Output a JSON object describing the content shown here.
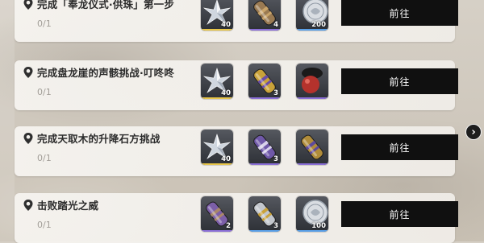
{
  "quests": [
    {
      "title": "完成「奉龙仪式·供珠」第一步",
      "progress": "0/1",
      "go_label": "前往",
      "rewards": [
        {
          "icon": "silver-star-crystal-icon",
          "qty": "40",
          "rarity_color": "#e8c64a"
        },
        {
          "icon": "bronze-capsule-icon",
          "qty": "4",
          "rarity_color": "#8b6fd8"
        },
        {
          "icon": "silver-coin-icon",
          "qty": "200",
          "rarity_color": "#5aa0e8"
        }
      ]
    },
    {
      "title": "完成盘龙崖的声骸挑战·叮咚咚",
      "progress": "0/1",
      "go_label": "前往",
      "rewards": [
        {
          "icon": "silver-star-crystal-icon",
          "qty": "40",
          "rarity_color": "#e8c64a"
        },
        {
          "icon": "gold-capsule-icon",
          "qty": "3",
          "rarity_color": "#8b6fd8"
        },
        {
          "icon": "red-orb-icon",
          "qty": "",
          "rarity_color": "#8b6fd8"
        }
      ]
    },
    {
      "title": "完成天取木的升降石方挑战",
      "progress": "0/1",
      "go_label": "前往",
      "rewards": [
        {
          "icon": "silver-star-crystal-icon",
          "qty": "40",
          "rarity_color": "#e8c64a"
        },
        {
          "icon": "purple-capsule-icon",
          "qty": "3",
          "rarity_color": "#8b6fd8"
        },
        {
          "icon": "gold-purple-capsule-icon",
          "qty": "",
          "rarity_color": "#8b6fd8"
        }
      ]
    },
    {
      "title": "击败踏光之威",
      "progress": "0/1",
      "go_label": "前往",
      "rewards": [
        {
          "icon": "purple-bronze-capsule-icon",
          "qty": "2",
          "rarity_color": "#8b6fd8"
        },
        {
          "icon": "silver-gold-capsule-icon",
          "qty": "3",
          "rarity_color": "#5aa0e8"
        },
        {
          "icon": "silver-coin-icon",
          "qty": "100",
          "rarity_color": "#5aa0e8"
        }
      ]
    }
  ],
  "scroll_arrow_icon": "chevron-right-icon"
}
